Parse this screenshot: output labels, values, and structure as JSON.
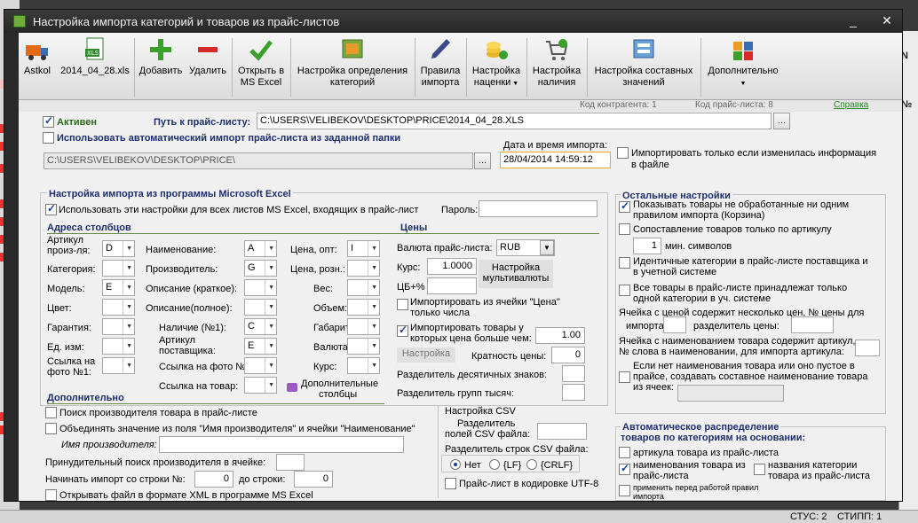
{
  "window": {
    "title": "Настройка импорта категорий и товаров из прайс-листов"
  },
  "toolbar": {
    "astkol": "Astkol",
    "file": "2014_04_28.xls",
    "add": "Добавить",
    "delete": "Удалить",
    "open_excel_1": "Открыть в",
    "open_excel_2": "MS Excel",
    "detect_cat_1": "Настройка определения",
    "detect_cat_2": "категорий",
    "rules_1": "Правила",
    "rules_2": "импорта",
    "markup_1": "Настройка",
    "markup_2": "наценки",
    "stock_1": "Настройка",
    "stock_2": "наличия",
    "composite_1": "Настройка составных",
    "composite_2": "значений",
    "extra": "Дополнительно"
  },
  "info": {
    "contractor_code": "Код контрагента: 1",
    "pricelist_code": "Код прайс-листа: 8",
    "help": "Справка"
  },
  "top": {
    "active": "Активен",
    "path_label": "Путь к прайс-листу:",
    "path_value": "C:\\USERS\\VELIBEKOV\\DESKTOP\\PRICE\\2014_04_28.XLS",
    "browse": "...",
    "auto_import": "Использовать автоматический импорт прайс-листа из заданной папки",
    "folder_value": "C:\\USERS\\VELIBEKOV\\DESKTOP\\PRICE\\",
    "datetime_label": "Дата и время импорта:",
    "datetime_value": "28/04/2014 14:59:12",
    "only_changed_1": "Импортировать только если изменилась информация",
    "only_changed_2": "в файле"
  },
  "excel": {
    "title": "Настройка импорта из программы Microsoft Excel",
    "use_all_sheets": "Использовать эти настройки для всех листов MS Excel, входящих в прайс-лист",
    "password_label": "Пароль:",
    "columns_title": "Адреса столбцов",
    "article_1": "Артикул",
    "article_2": "произ-ля:",
    "article_val": "D",
    "category": "Категория:",
    "model": "Модель:",
    "model_val": "E",
    "color": "Цвет:",
    "warranty": "Гарантия:",
    "unit": "Ед. изм:",
    "photo1_1": "Ссылка на",
    "photo1_2": "фото №1:",
    "name": "Наименование:",
    "name_val": "A",
    "producer": "Производитель:",
    "producer_val": "G",
    "desc_short": "Описание (краткое):",
    "desc_full": "Описание(полное):",
    "stock1": "Наличие (№1):",
    "stock1_val": "C",
    "supplier_art_1": "Артикул",
    "supplier_art_2": "поставщика:",
    "supplier_art_val": "E",
    "photo2": "Ссылка на фото №2:",
    "product_link": "Ссылка на товар:",
    "price_opt": "Цена, опт:",
    "price_opt_val": "I",
    "price_retail": "Цена, розн.:",
    "weight": "Вес:",
    "volume": "Объем:",
    "dimensions": "Габарит:",
    "currency": "Валюта:",
    "rate": "Курс:",
    "extra_cols_1": "Дополнительные",
    "extra_cols_2": "столбцы",
    "prices_title": "Цены",
    "pl_currency": "Валюта прайс-листа:",
    "pl_currency_val": "RUB",
    "rate_label": "Курс:",
    "rate_val": "1.0000",
    "cb_label": "ЦБ+%",
    "multi_currency_1": "Настройка",
    "multi_currency_2": "мультивалюты",
    "import_price_cell_1": "Импортировать из ячейки \"Цена\"",
    "import_price_cell_2": "только числа",
    "import_over_1": "Импортировать товары у",
    "import_over_2": "которых цена больше чем:",
    "import_over_val": "1.00",
    "setup_btn": "Настройка",
    "multiplicity": "Кратность цены:",
    "multiplicity_val": "0",
    "decimal_sep": "Разделитель десятичных знаков:",
    "thousand_sep": "Разделитель групп тысяч:"
  },
  "additional": {
    "title": "Дополнительно",
    "search_producer": "Поиск производителя товара в прайс-листе",
    "merge_1": "Объединять значение из поля \"Имя производителя\" и ячейки \"Наименование\"",
    "producer_name": "Имя производителя:",
    "forced_search": "Принудительный поиск производителя в ячейке:",
    "start_row": "Начинать импорт со строки №:",
    "start_row_val": "0",
    "to_row": "до строки:",
    "to_row_val": "0",
    "open_xml": "Открывать файл в формате XML в программе MS Excel"
  },
  "csv": {
    "title": "Настройка CSV",
    "field_sep_1": "Разделитель",
    "field_sep_2": "полей CSV файла:",
    "row_sep": "Разделитель строк CSV файла:",
    "opt_none": "Нет",
    "opt_lf": "{LF}",
    "opt_crlf": "{CRLF}",
    "utf8": "Прайс-лист в кодировке UTF-8"
  },
  "other": {
    "title": "Остальные настройки",
    "show_unprocessed_1": "Показывать товары не обработанные ни одним",
    "show_unprocessed_2": "правилом импорта (Корзина)",
    "match_article": "Сопоставление товаров только по артикулу",
    "min_chars_val": "1",
    "min_chars": "мин. символов",
    "same_categories_1": "Идентичные категории в прайс-листе поставщика и",
    "same_categories_2": "в учетной системе",
    "one_category_1": "Все товары в прайс-листе принадлежат только",
    "one_category_2": "одной категории в уч. системе",
    "multi_prices_1": "Ячейка с ценой содержит несколько цен, № цены для",
    "multi_prices_2": "импорта:",
    "price_sep": "разделитель цены:",
    "name_article_1": "Ячейка с наименованием товара содержит артикул,",
    "name_article_2": "№ слова в наименовании, для импорта артикула:",
    "composite_name_1": "Если нет наименования товара или оно пустое в",
    "composite_name_2": "прайсе, создавать составное наименование товара",
    "composite_name_3": "из ячеек:"
  },
  "auto_dist": {
    "title_1": "Автоматическое распределение",
    "title_2": "товаров по категориям на основании:",
    "article": "артикула товара из прайс-листа",
    "name_1": "наименования товара из",
    "name_2": "прайс-листа",
    "cat_names_1": "названия  категории",
    "cat_names_2": "товара из прайс-листа",
    "apply_1": "применить перед работой правил",
    "apply_2": "импорта"
  },
  "status": {
    "stus": "СТУС: 2",
    "stipp": "СТИПП: 1"
  },
  "colors": {
    "accent": "#1d2e6e",
    "check": "#1b3f8f",
    "highlight": "#f5a623"
  }
}
